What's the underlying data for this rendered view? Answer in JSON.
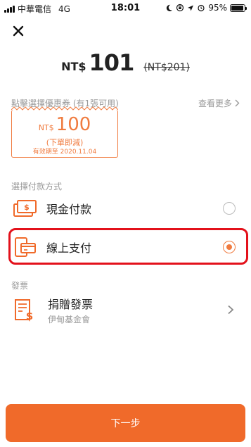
{
  "status_bar": {
    "carrier": "中華電信",
    "network": "4G",
    "time": "18:01",
    "battery_percent": "95%",
    "battery_level": 0.95
  },
  "price": {
    "currency": "NT$",
    "amount": "101",
    "original": "(NT$201)"
  },
  "coupon": {
    "section_title": "點擊選擇優惠券 (有1張可用)",
    "see_more": "查看更多",
    "currency": "NT$",
    "amount": "100",
    "subtitle": "(下單即減)",
    "expiry": "有效期至 2020.11.04"
  },
  "payment": {
    "section_title": "選擇付款方式",
    "options": [
      {
        "label": "現金付款",
        "selected": false
      },
      {
        "label": "線上支付",
        "selected": true
      }
    ]
  },
  "invoice": {
    "section_title": "發票",
    "title": "捐贈發票",
    "subtitle": "伊甸基金會"
  },
  "next_button": {
    "label": "下一步"
  },
  "colors": {
    "accent": "#f06a2a",
    "coupon": "#f07b3f",
    "highlight": "#e3111b"
  }
}
